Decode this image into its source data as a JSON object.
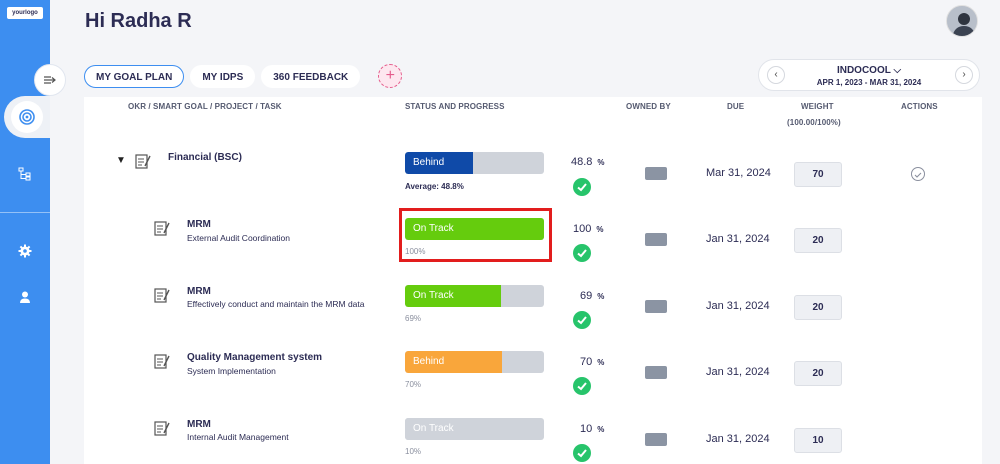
{
  "logo": "yourlogo",
  "greeting": "Hi Radha R",
  "tabs": [
    "MY GOAL PLAN",
    "MY IDPS",
    "360 FEEDBACK"
  ],
  "add_label": "+",
  "org": {
    "name": "INDOCOOL ⌵",
    "dates": "APR 1, 2023 - MAR 31, 2024",
    "prev": "‹",
    "next": "›"
  },
  "columns": {
    "okr": "OKR / SMART GOAL / PROJECT / TASK",
    "status": "STATUS AND PROGRESS",
    "owned": "OWNED BY",
    "due": "DUE",
    "weight": "WEIGHT",
    "weight_total": "(100.00/100%)",
    "actions": "ACTIONS"
  },
  "colors": {
    "behind_blue": "#0f4aa8",
    "on_track": "#65cc0d",
    "behind_orange": "#f9a63b",
    "check": "#27c46b",
    "highlight": "#e21d1d"
  },
  "rows": [
    {
      "title": "Financial (BSC)",
      "subtitle": "",
      "status": "Behind",
      "progress": 48.8,
      "note": "Average: 48.8%",
      "pct": "48.8",
      "due": "Mar 31, 2024",
      "weight": "70"
    },
    {
      "title": "MRM",
      "subtitle": "External Audit Coordination",
      "status": "On Track",
      "progress": 100,
      "note": "100%",
      "pct": "100",
      "due": "Jan 31, 2024",
      "weight": "20"
    },
    {
      "title": "MRM",
      "subtitle": "Effectively conduct and maintain the MRM data",
      "status": "On Track",
      "progress": 69,
      "note": "69%",
      "pct": "69",
      "due": "Jan 31, 2024",
      "weight": "20"
    },
    {
      "title": "Quality Management system",
      "subtitle": "System Implementation",
      "status": "Behind",
      "progress": 70,
      "note": "70%",
      "pct": "70",
      "due": "Jan 31, 2024",
      "weight": "20"
    },
    {
      "title": "MRM",
      "subtitle": "Internal Audit Management",
      "status": "On Track",
      "progress": 10,
      "note": "10%",
      "pct": "10",
      "due": "Jan 31, 2024",
      "weight": "10"
    }
  ],
  "pct_symbol": "%"
}
